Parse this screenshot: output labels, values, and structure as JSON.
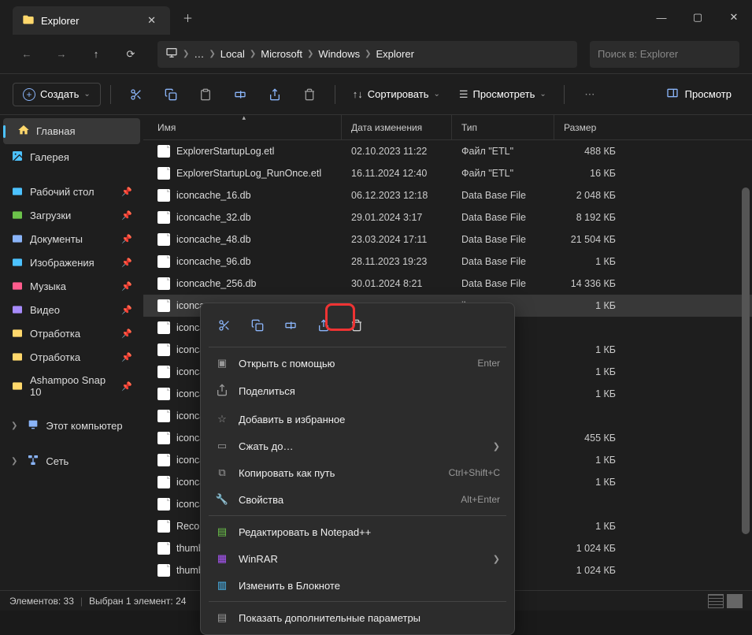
{
  "window": {
    "title": "Explorer",
    "controls": {
      "min": "—",
      "max": "▢",
      "close": "✕"
    }
  },
  "breadcrumb": {
    "monitor_icon": "🖥",
    "ellipsis": "…",
    "items": [
      "Local",
      "Microsoft",
      "Windows",
      "Explorer"
    ]
  },
  "search": {
    "placeholder": "Поиск в: Explorer"
  },
  "toolbar": {
    "create": "Создать",
    "sort": "Сортировать",
    "view": "Просмотреть",
    "preview": "Просмотр"
  },
  "sidebar": {
    "home": "Главная",
    "gallery": "Галерея",
    "items": [
      {
        "label": "Рабочий стол",
        "icon": "desktop",
        "color": "#4cc2ff"
      },
      {
        "label": "Загрузки",
        "icon": "download",
        "color": "#6cc24a"
      },
      {
        "label": "Документы",
        "icon": "doc",
        "color": "#8ab4f8"
      },
      {
        "label": "Изображения",
        "icon": "image",
        "color": "#4cc2ff"
      },
      {
        "label": "Музыка",
        "icon": "music",
        "color": "#ff5c8d"
      },
      {
        "label": "Видео",
        "icon": "video",
        "color": "#a78bfa"
      },
      {
        "label": "Отработка",
        "icon": "folder",
        "color": "#ffd86c"
      },
      {
        "label": "Отработка",
        "icon": "folder",
        "color": "#ffd86c"
      },
      {
        "label": "Ashampoo Snap 10",
        "icon": "folder",
        "color": "#ffd86c"
      }
    ],
    "computer": "Этот компьютер",
    "network": "Сеть"
  },
  "columns": {
    "name": "Имя",
    "date": "Дата изменения",
    "type": "Тип",
    "size": "Размер"
  },
  "files": [
    {
      "name": "ExplorerStartupLog.etl",
      "date": "02.10.2023 11:22",
      "type": "Файл \"ETL\"",
      "size": "488 КБ"
    },
    {
      "name": "ExplorerStartupLog_RunOnce.etl",
      "date": "16.11.2024 12:40",
      "type": "Файл \"ETL\"",
      "size": "16 КБ"
    },
    {
      "name": "iconcache_16.db",
      "date": "06.12.2023 12:18",
      "type": "Data Base File",
      "size": "2 048 КБ"
    },
    {
      "name": "iconcache_32.db",
      "date": "29.01.2024 3:17",
      "type": "Data Base File",
      "size": "8 192 КБ"
    },
    {
      "name": "iconcache_48.db",
      "date": "23.03.2024 17:11",
      "type": "Data Base File",
      "size": "21 504 КБ"
    },
    {
      "name": "iconcache_96.db",
      "date": "28.11.2023 19:23",
      "type": "Data Base File",
      "size": "1 КБ"
    },
    {
      "name": "iconcache_256.db",
      "date": "30.01.2024 8:21",
      "type": "Data Base File",
      "size": "14 336 КБ"
    },
    {
      "name": "iconcac",
      "date": "",
      "type": "ile",
      "size": "1 КБ",
      "selected": true
    },
    {
      "name": "iconcac",
      "date": "",
      "type": "",
      "size": ""
    },
    {
      "name": "iconcac",
      "date": "",
      "type": "ile",
      "size": "1 КБ"
    },
    {
      "name": "iconcac",
      "date": "",
      "type": "ile",
      "size": "1 КБ"
    },
    {
      "name": "iconcac",
      "date": "",
      "type": "ile",
      "size": "1 КБ"
    },
    {
      "name": "iconcac",
      "date": "",
      "type": "",
      "size": ""
    },
    {
      "name": "iconcac",
      "date": "",
      "type": "ile",
      "size": "455 КБ"
    },
    {
      "name": "iconcac",
      "date": "",
      "type": "ile",
      "size": "1 КБ"
    },
    {
      "name": "iconcac",
      "date": "",
      "type": "ile",
      "size": "1 КБ"
    },
    {
      "name": "iconcac",
      "date": "",
      "type": "",
      "size": ""
    },
    {
      "name": "Recom",
      "date": "",
      "type": "N\"",
      "size": "1 КБ"
    },
    {
      "name": "thumb",
      "date": "",
      "type": "ile",
      "size": "1 024 КБ"
    },
    {
      "name": "thumb",
      "date": "",
      "type": "ile",
      "size": "1 024 КБ"
    }
  ],
  "context_menu": {
    "open_with": "Открыть с помощью",
    "share": "Поделиться",
    "favorite": "Добавить в избранное",
    "compress": "Сжать до…",
    "copy_path": "Копировать как путь",
    "properties": "Свойства",
    "notepadpp": "Редактировать в Notepad++",
    "winrar": "WinRAR",
    "notepad": "Изменить в Блокноте",
    "more": "Показать дополнительные параметры",
    "shortcuts": {
      "open_with": "Enter",
      "copy_path": "Ctrl+Shift+C",
      "properties": "Alt+Enter"
    }
  },
  "status": {
    "count": "Элементов: 33",
    "selected": "Выбран 1 элемент: 24"
  }
}
